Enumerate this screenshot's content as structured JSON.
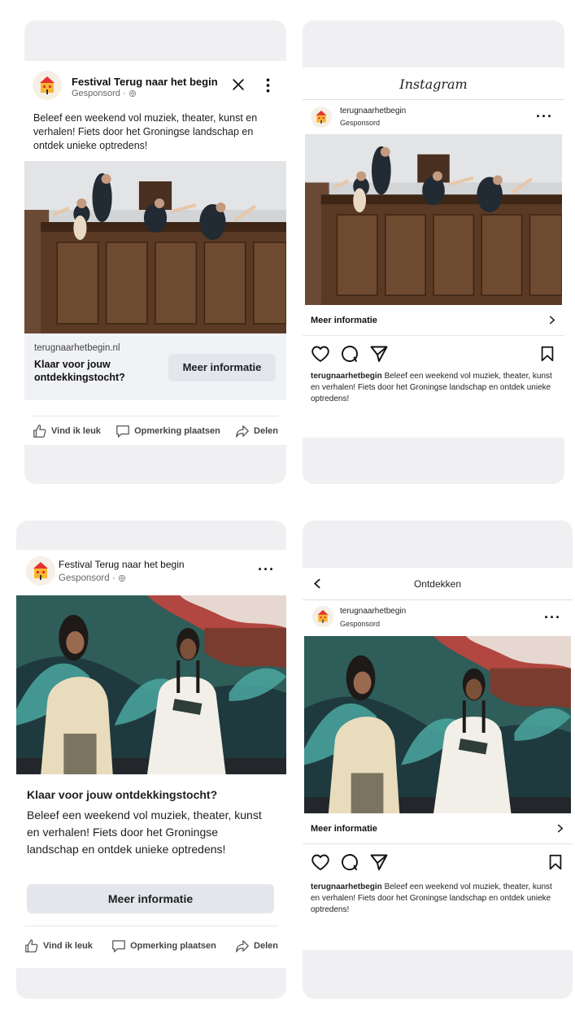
{
  "fb_feed": {
    "page_name": "Festival Terug naar het begin",
    "sponsored": "Gesponsord ·",
    "body_text": "Beleef een weekend vol muziek, theater, kunst en verhalen! Fiets door het Groningse landschap en ontdek unieke optredens!",
    "link_url": "terugnaarhetbegin.nl",
    "link_headline": "Klaar voor jouw ontdekkingstocht?",
    "cta": "Meer informatie",
    "like": "Vind ik leuk",
    "comment": "Opmerking plaatsen",
    "share": "Delen"
  },
  "ig_feed": {
    "app_title": "Instagram",
    "username": "terugnaarhetbegin",
    "sponsored": "Gesponsord",
    "cta": "Meer informatie",
    "caption_user": "terugnaarhetbegin",
    "caption_text": " Beleef een weekend vol muziek, theater, kunst en verhalen! Fiets door het Groningse landschap en ontdek unieke optredens!"
  },
  "fb_second": {
    "page_name": "Festival Terug naar het begin",
    "sponsored": "Gesponsord ·",
    "headline": "Klaar voor jouw ontdekkingstocht?",
    "body_text": "Beleef een weekend vol muziek, theater, kunst en verhalen! Fiets door het Groningse landschap en ontdek unieke optredens!",
    "cta": "Meer informatie",
    "like": "Vind ik leuk",
    "comment": "Opmerking plaatsen",
    "share": "Delen"
  },
  "ig_explore": {
    "title": "Ontdekken",
    "username": "terugnaarhetbegin",
    "sponsored": "Gesponsord",
    "cta": "Meer informatie",
    "caption_user": "terugnaarhetbegin",
    "caption_text": " Beleef een weekend vol muziek, theater, kunst en verhalen! Fiets door het Groningse landschap en ontdek unieke optredens!"
  },
  "colors": {
    "phone_bg": "#f0f0f2",
    "button_grey": "#e4e6eb",
    "secondary_text": "#65676b"
  },
  "icons": [
    "logo-icon",
    "globe-icon",
    "close-icon",
    "more-icon",
    "like-icon",
    "comment-icon",
    "share-icon",
    "heart-icon",
    "search-icon",
    "send-icon",
    "bookmark-icon",
    "chevron-right-icon",
    "back-icon"
  ]
}
